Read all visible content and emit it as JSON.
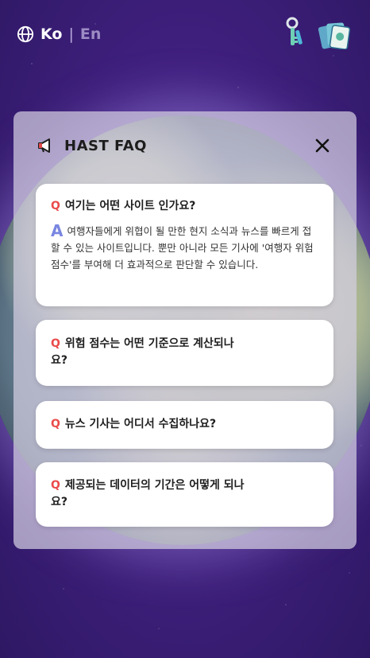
{
  "header": {
    "lang_active": "Ko",
    "lang_separator": "|",
    "lang_inactive": "En",
    "icons": [
      "globe-icon",
      "keys-icon",
      "cards-icon"
    ]
  },
  "faq": {
    "title": "HAST FAQ",
    "q_marker": "Q",
    "a_marker": "A",
    "items": [
      {
        "question": "여기는 어떤 사이트 인가요?",
        "answer": "여행자들에게 위협이 될 만한 현지 소식과 뉴스를 빠르게 접할 수 있는 사이트입니다. 뿐만 아니라 모든 기사에 '여행자 위험 점수'를 부여해 더 효과적으로 판단할 수 있습니다.",
        "expanded": true
      },
      {
        "question": "위험 점수는 어떤 기준으로 계산되나요?",
        "expanded": false
      },
      {
        "question": "뉴스 기사는 어디서 수집하나요?",
        "expanded": false
      },
      {
        "question": "제공되는 데이터의 기간은 어떻게 되나요?",
        "expanded": false
      }
    ]
  },
  "colors": {
    "background": "#3b1f73",
    "q_marker": "#ea4b4b",
    "a_marker": "#7a86e0"
  }
}
